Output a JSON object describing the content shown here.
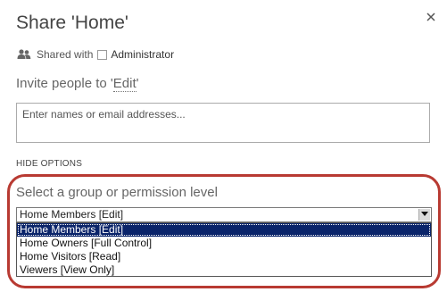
{
  "dialog": {
    "title": "Share 'Home'",
    "close_glyph": "×"
  },
  "shared_with": {
    "label": "Shared with",
    "user": "Administrator"
  },
  "invite": {
    "prefix": "Invite people to '",
    "permission": "Edit",
    "suffix": "'"
  },
  "names_input": {
    "placeholder": "Enter names or email addresses..."
  },
  "hide_options_label": "HIDE OPTIONS",
  "group_select": {
    "label": "Select a group or permission level",
    "selected": "Home Members [Edit]",
    "options": [
      "Home Members [Edit]",
      "Home Owners [Full Control]",
      "Home Visitors [Read]",
      "Viewers [View Only]"
    ]
  },
  "colors": {
    "highlight_ring": "#b83a32",
    "selected_option_bg": "#0a246a"
  }
}
